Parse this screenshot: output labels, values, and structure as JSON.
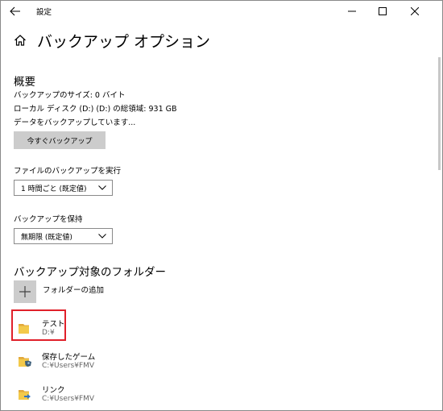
{
  "window": {
    "title": "設定",
    "back_icon": "arrow-left-icon",
    "controls": [
      "minimize-icon",
      "maximize-icon",
      "close-icon"
    ]
  },
  "header": {
    "home_icon": "home-icon",
    "title": "バックアップ オプション"
  },
  "overview": {
    "heading": "概要",
    "size_text": "バックアップのサイズ: 0 バイト",
    "disk_text": "ローカル ディスク (D:) (D:) の総領域: 931 GB",
    "status_text": "データをバックアップしています...",
    "backup_now_label": "今すぐバックアップ"
  },
  "run_backup": {
    "label": "ファイルのバックアップを実行",
    "selected": "1 時間ごと (既定値)"
  },
  "keep_backup": {
    "label": "バックアップを保持",
    "selected": "無期限 (既定値)"
  },
  "folders": {
    "heading": "バックアップ対象のフォルダー",
    "add_label": "フォルダーの追加",
    "items": [
      {
        "name": "テスト",
        "path": "D:¥",
        "icon": "folder-icon"
      },
      {
        "name": "保存したゲーム",
        "path": "C:¥Users¥FMV",
        "icon": "saved-games-folder-icon"
      },
      {
        "name": "リンク",
        "path": "C:¥Users¥FMV",
        "icon": "links-folder-icon"
      }
    ]
  },
  "colors": {
    "highlight": "#e0202a",
    "button_bg": "#cccccc",
    "folder_yellow": "#f3c94a",
    "secondary_text": "#666666"
  }
}
